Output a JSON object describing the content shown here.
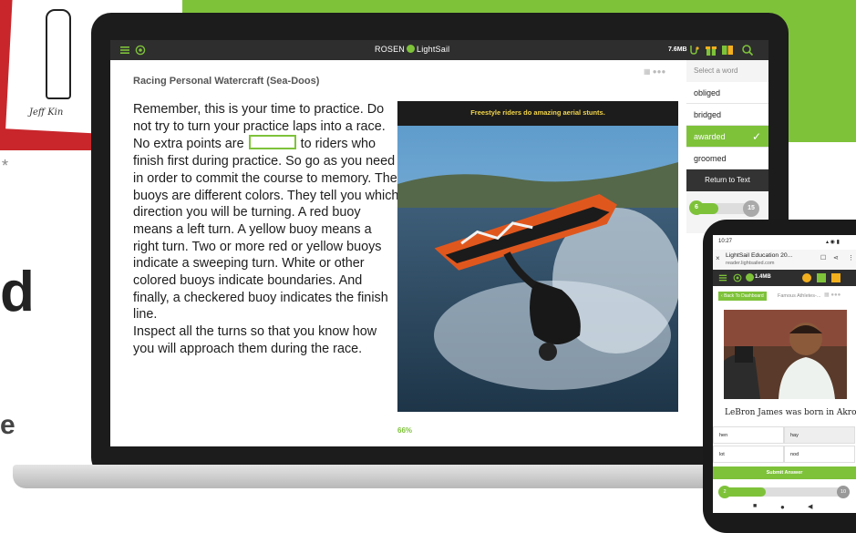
{
  "background": {
    "book_signature": "Jeff Kin",
    "partial_letters": [
      "*",
      "d",
      "e"
    ],
    "accent": "#7ec23a"
  },
  "laptop": {
    "app_name": "ROSEN LightSail",
    "brand_left": "ROSEN",
    "brand_right": "LightSail",
    "file_size": "7.6MB",
    "toolbar_icons": [
      "menu-icon",
      "settings-icon",
      "hint-icon",
      "gift-icon",
      "book-icon",
      "search-icon"
    ],
    "book_title": "Racing Personal Watercraft (Sea-Doos)",
    "passage_before_blank": "Remember, this is your time to practice. Do not try to turn your practice laps into a race. No extra points are",
    "passage_after_blank": "to riders who finish first during practice. So go as you need in order to commit the course to memory. The buoys are different colors. They tell you which direction you will be turning. A red buoy means a left turn. A yellow buoy means a right turn. Two or more red or yellow buoys indicate a sweeping turn. White or other colored buoys indicate boundaries. And finally, a checkered buoy indicates the finish line.",
    "passage_paragraph_2": "Inspect all the turns so that you know how you will approach them during the race.",
    "photo_caption": "Freestyle riders do amazing aerial stunts.",
    "progress_percent": "66%",
    "word_panel": {
      "header": "Select a word",
      "options": [
        "obliged",
        "bridged",
        "awarded",
        "groomed"
      ],
      "selected": "awarded",
      "return_label": "Return to Text",
      "progress_current": "6",
      "progress_max": "15",
      "progress_fraction": 0.4
    }
  },
  "phone": {
    "status_time": "10:27",
    "tab_title": "LightSail Education 20...",
    "url": "reader.lightsailed.com",
    "file_size": "1.4MB",
    "back_button": "Back To Dashboard",
    "doc_title": "Famous Athletes-...",
    "passage_text": "LeBron James was born in Akron,",
    "word_options": [
      "hen",
      "hay",
      "lot",
      "nod"
    ],
    "submit_label": "Submit Answer",
    "progress_current": "2",
    "progress_max": "10",
    "progress_fraction": 0.35
  }
}
